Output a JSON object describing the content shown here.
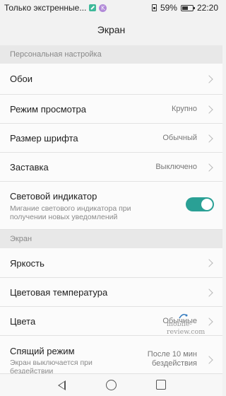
{
  "status_bar": {
    "left_text": "Только экстренные...",
    "battery": "59%",
    "battery_level": 0.59,
    "time": "22:20",
    "icons": [
      "green-app-icon",
      "k-app-icon",
      "sim-icon",
      "battery-icon"
    ]
  },
  "header": {
    "title": "Экран"
  },
  "sections": {
    "personal": "Персональная настройка",
    "screen": "Экран"
  },
  "items": {
    "wallpaper": {
      "title": "Обои"
    },
    "view_mode": {
      "title": "Режим просмотра",
      "value": "Крупно"
    },
    "font_size": {
      "title": "Размер шрифта",
      "value": "Обычный"
    },
    "screensaver": {
      "title": "Заставка",
      "value": "Выключено"
    },
    "led": {
      "title": "Световой индикатор",
      "subtitle": "Мигание светового индикатора при получении новых уведомлений",
      "toggle_on": true,
      "toggle_color": "#2aa095"
    },
    "brightness": {
      "title": "Яркость"
    },
    "color_temp": {
      "title": "Цветовая температура"
    },
    "colors": {
      "title": "Цвета",
      "value": "Обычные"
    },
    "sleep": {
      "title": "Спящий режим",
      "subtitle": "Экран выключается при бездействии",
      "value_line1": "После 10 мин",
      "value_line2": "бездействия"
    }
  },
  "watermark": "mobile-review.com",
  "nav": {
    "icons": [
      "back-icon",
      "home-icon",
      "recent-apps-icon"
    ]
  }
}
